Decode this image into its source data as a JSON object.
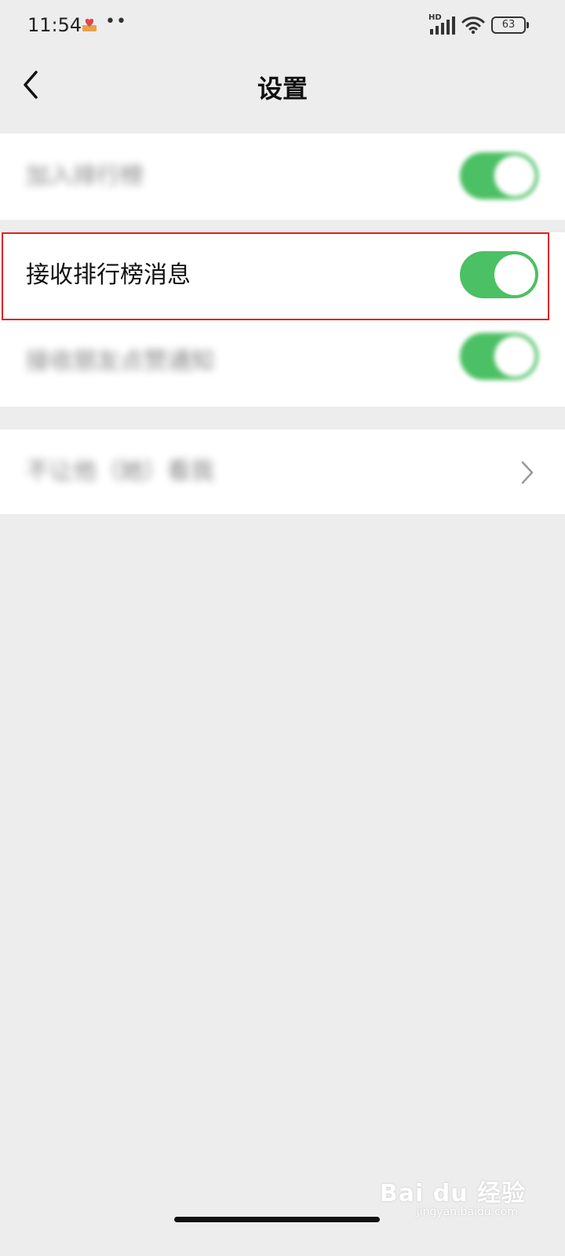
{
  "status_bar": {
    "time": "11:54",
    "dots": "••",
    "network": "HD",
    "battery": "63"
  },
  "header": {
    "title": "设置"
  },
  "settings": {
    "rows": [
      {
        "label": "加入排行榜",
        "toggle_on": true
      },
      {
        "label": "接收排行榜消息",
        "toggle_on": true
      },
      {
        "label": "接收朋友点赞通知",
        "toggle_on": true
      },
      {
        "label": "不让他（她）看我"
      }
    ]
  },
  "watermark": {
    "text": "Bai du 经验",
    "sub": "jingyan.baidu.com"
  },
  "colors": {
    "accent": "#4cc064",
    "highlight": "#e02020",
    "background": "#ededed"
  }
}
